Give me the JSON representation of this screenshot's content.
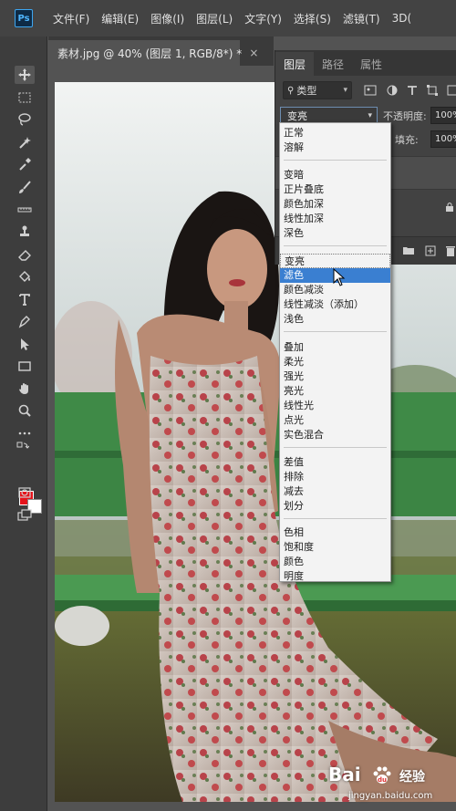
{
  "app": {
    "logo": "Ps"
  },
  "menubar": {
    "items": [
      "文件(F)",
      "编辑(E)",
      "图像(I)",
      "图层(L)",
      "文字(Y)",
      "选择(S)",
      "滤镜(T)",
      "3D("
    ]
  },
  "toolbar": {
    "tools": [
      "move-tool",
      "marquee-tool",
      "lasso-tool",
      "quick-select-tool",
      "eyedropper-tool",
      "brush-tool",
      "eraser-stamp-tool",
      "clone-stamp-tool",
      "eraser-tool",
      "paint-bucket-tool",
      "type-tool",
      "pen-tool",
      "path-select-tool",
      "rectangle-tool",
      "hand-tool",
      "zoom-tool",
      "more-tools",
      "swap-colors",
      "quick-mask",
      "screen-mode"
    ],
    "foreground_color": "#e5131b",
    "background_color": "#ffffff"
  },
  "document": {
    "tab_label": "素材.jpg @ 40% (图层 1, RGB/8*) *",
    "close_glyph": "×"
  },
  "layers_panel": {
    "tabs": [
      "图层",
      "路径",
      "属性"
    ],
    "active_tab": "图层",
    "filter_label": "类型",
    "blend_mode_value": "变亮",
    "opacity_label": "不透明度:",
    "opacity_value": "100%",
    "fill_label": "填充:",
    "fill_value": "100%"
  },
  "blend_dropdown": {
    "groups": [
      [
        "正常",
        "溶解"
      ],
      [
        "变暗",
        "正片叠底",
        "颜色加深",
        "线性加深",
        "深色"
      ],
      [
        "变亮",
        "滤色",
        "颜色减淡",
        "线性减淡（添加）",
        "浅色"
      ],
      [
        "叠加",
        "柔光",
        "强光",
        "亮光",
        "线性光",
        "点光",
        "实色混合"
      ],
      [
        "差值",
        "排除",
        "减去",
        "划分"
      ],
      [
        "色相",
        "饱和度",
        "颜色",
        "明度"
      ]
    ],
    "current": "变亮",
    "highlighted": "滤色",
    "highlight_color": "#3a7fd1"
  },
  "watermark": {
    "brand": "Bai",
    "word": "经验",
    "url": "jingyan.baidu.com"
  }
}
